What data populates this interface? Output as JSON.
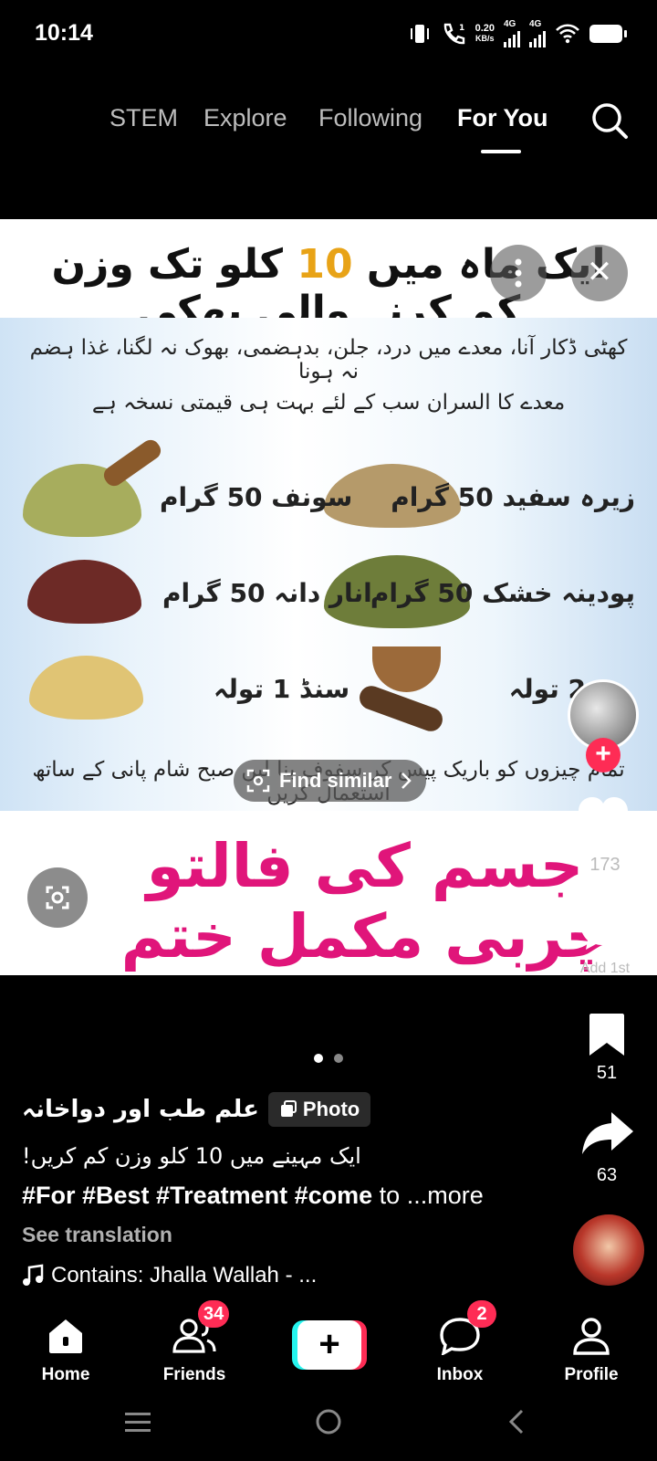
{
  "status_bar": {
    "time": "10:14",
    "net_speed_value": "0.20",
    "net_speed_unit": "KB/s",
    "network1": "4G",
    "network2": "4G"
  },
  "top_tabs": {
    "items": [
      "STEM",
      "Explore",
      "Following",
      "For You"
    ],
    "active": "For You"
  },
  "post_image": {
    "title_before": "ایک ماہ میں",
    "title_number": "10",
    "title_after": "کلو تک وزن کم کرنے والی پھکی",
    "intro_line1": "کھٹی ڈکار آنا، معدے میں درد، جلن، بدہضمی، بھوک نہ لگنا، غذا ہضم نہ ہونا",
    "intro_line2": "معدے کا السران سب کے لئے بہت ہی قیمتی نسخہ ہے",
    "ingredients": [
      "زیرہ سفید 50 گرام",
      "سونف 50 گرام",
      "پودینہ خشک 50 گرام",
      "انار دانہ 50 گرام",
      "2 تولہ",
      "سنڈ 1 تولہ"
    ],
    "instructions": "تمام چیزوں کو باریک پیس کر سفوف بنا لیں صبح شام پانی کے ساتھ استعمال کریں",
    "footer_text": "جسم کی فالتو چربی مکمل ختم",
    "find_similar_label": "Find similar"
  },
  "right_rail": {
    "likes": "173",
    "comments": "Add 1st",
    "saves": "51",
    "shares": "63"
  },
  "caption": {
    "author": "علم طب اور دواخانہ",
    "tag": "Photo",
    "line1": "ایک مہینے میں 10 کلو وزن کم کریں!",
    "hashtags": "#For #Best #Treatment #come",
    "tail": " to ...more",
    "see_translation": "See translation",
    "music": "Contains: Jhalla Wallah - ..."
  },
  "bottom_nav": {
    "home": "Home",
    "friends": "Friends",
    "friends_badge": "34",
    "inbox": "Inbox",
    "inbox_badge": "2",
    "profile": "Profile"
  },
  "colors": {
    "accent": "#fe2c55",
    "teal": "#25f4ee",
    "title_number": "#e8a317",
    "footer_pink": "#e0157a"
  }
}
